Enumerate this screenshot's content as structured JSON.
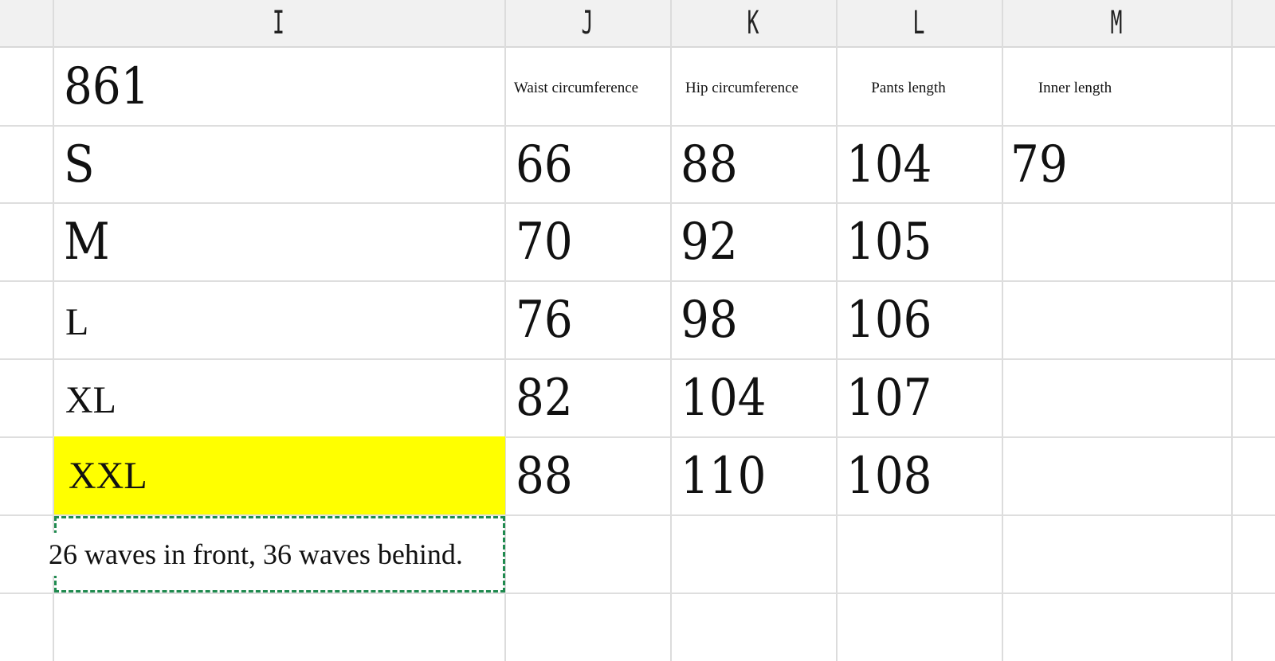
{
  "columns": [
    "I",
    "J",
    "K",
    "L",
    "M"
  ],
  "row1": {
    "style": "861",
    "headers": [
      "Waist circumference",
      "Hip circumference",
      "Pants length",
      "Inner length"
    ]
  },
  "sizes": [
    {
      "label": "S",
      "waist": "66",
      "hip": "88",
      "length": "104",
      "inner": "79"
    },
    {
      "label": "M",
      "waist": "70",
      "hip": "92",
      "length": "105",
      "inner": ""
    },
    {
      "label": "L",
      "waist": "76",
      "hip": "98",
      "length": "106",
      "inner": ""
    },
    {
      "label": "XL",
      "waist": "82",
      "hip": "104",
      "length": "107",
      "inner": ""
    },
    {
      "label": "XXL",
      "waist": "88",
      "hip": "110",
      "length": "108",
      "inner": ""
    }
  ],
  "note": "26 waves in front, 36 waves behind.",
  "highlight_color": "#ffff00",
  "selection_border_color": "#1f8a4f"
}
